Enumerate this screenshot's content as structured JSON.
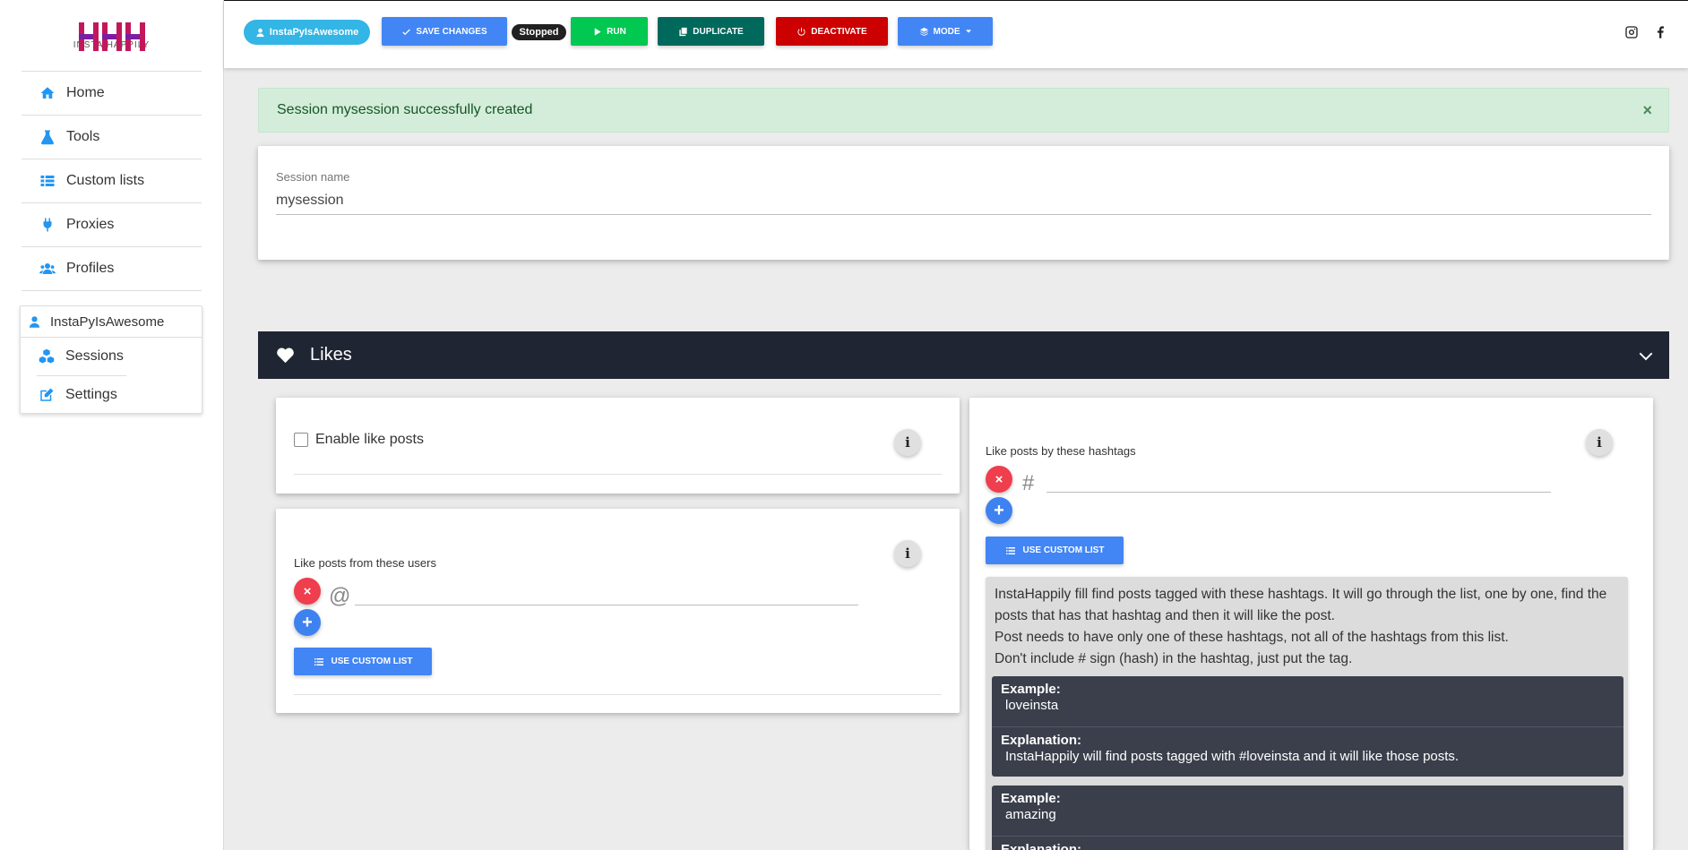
{
  "sidebar": {
    "logo_text": "INSTA HAPPILY",
    "nav": [
      {
        "label": "Home",
        "icon": "home-icon"
      },
      {
        "label": "Tools",
        "icon": "flask-icon"
      },
      {
        "label": "Custom lists",
        "icon": "list-icon"
      },
      {
        "label": "Proxies",
        "icon": "plug-icon"
      },
      {
        "label": "Profiles",
        "icon": "users-icon"
      }
    ],
    "user": {
      "name": "InstaPyIsAwesome",
      "items": [
        {
          "label": "Sessions",
          "icon": "cubes-icon"
        },
        {
          "label": "Settings",
          "icon": "edit-icon"
        }
      ]
    }
  },
  "toolbar": {
    "user_chip": "InstaPyIsAwesome",
    "save_label": "SAVE CHANGES",
    "status_badge": "Stopped",
    "run_label": "RUN",
    "duplicate_label": "DUPLICATE",
    "deactivate_label": "DEACTIVATE",
    "mode_label": "MODE",
    "colors": {
      "save": "#4285f4",
      "run": "#00c851",
      "duplicate": "#00695c",
      "deactivate": "#cc0000",
      "mode": "#4285f4",
      "chip": "#33b5e5"
    }
  },
  "alert": {
    "message": "Session mysession successfully created",
    "close": "×"
  },
  "session": {
    "label": "Session name",
    "value": "mysession"
  },
  "likes": {
    "title": "Likes",
    "enable_label": "Enable like posts",
    "enabled": false,
    "users_label": "Like posts from these users",
    "users_symbol": "@",
    "hashtags_label": "Like posts by these hashtags",
    "hashtags_symbol": "#",
    "use_custom_list": "USE CUSTOM LIST",
    "remove": "×",
    "add": "+",
    "info": "i",
    "description": [
      "InstaHappily fill find posts tagged with these hashtags. It will go through the list, one by one, find the posts that has that hashtag and then it will like the post.",
      "Post needs to have only one of these hashtags, not all of the hashtags from this list.",
      "Don't include # sign (hash) in the hashtag, just put the tag."
    ],
    "examples": [
      {
        "example_label": "Example:",
        "example": "loveinsta",
        "explanation_label": "Explanation:",
        "explanation": "InstaHappily will find posts tagged with #loveinsta and it will like those posts."
      },
      {
        "example_label": "Example:",
        "example": "amazing",
        "explanation_label": "Explanation:",
        "explanation": ""
      }
    ]
  }
}
